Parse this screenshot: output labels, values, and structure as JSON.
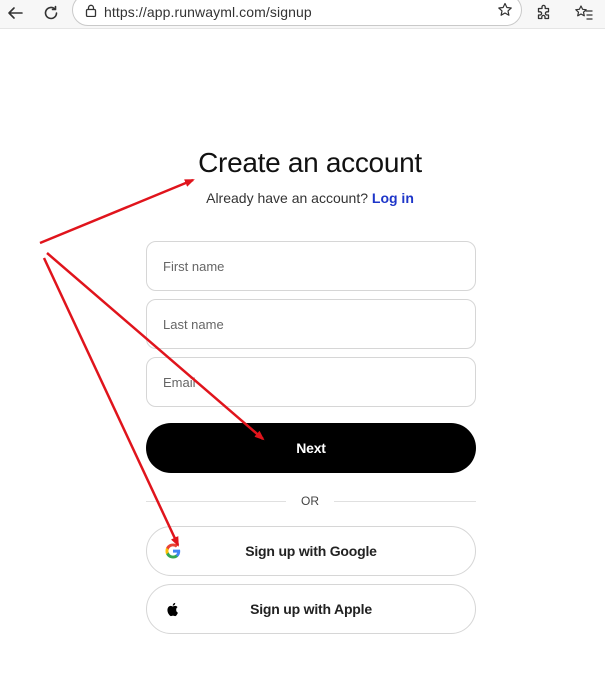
{
  "browser": {
    "url": "https://app.runwayml.com/signup",
    "icons": [
      "back-arrow-icon",
      "reload-icon",
      "lock-icon",
      "star-icon",
      "extensions-icon",
      "favorites-icon"
    ]
  },
  "signup": {
    "title": "Create an account",
    "subtitle_prefix": "Already have an account?",
    "login_link": "Log in",
    "first_name_placeholder": "First name",
    "last_name_placeholder": "Last name",
    "email_placeholder": "Email",
    "next_label": "Next",
    "or_label": "OR",
    "google_label": "Sign up with Google",
    "apple_label": "Sign up with Apple"
  },
  "colors": {
    "accent_link": "#1e36c9",
    "primary_button": "#000000",
    "annotation_arrow": "#e0141c"
  }
}
